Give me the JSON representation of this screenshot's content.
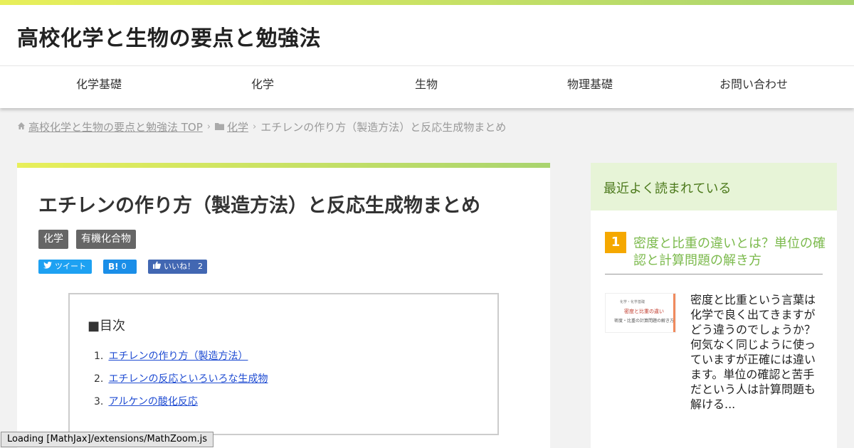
{
  "site": {
    "title": "高校化学と生物の要点と勉強法"
  },
  "nav": [
    {
      "label": "化学基礎"
    },
    {
      "label": "化学"
    },
    {
      "label": "生物"
    },
    {
      "label": "物理基礎"
    },
    {
      "label": "お問い合わせ"
    }
  ],
  "breadcrumb": {
    "home": "高校化学と生物の要点と勉強法 TOP",
    "category": "化学",
    "current": "エチレンの作り方（製造方法）と反応生成物まとめ"
  },
  "article": {
    "title": "エチレンの作り方（製造方法）と反応生成物まとめ",
    "tags": [
      "化学",
      "有機化合物"
    ],
    "share": {
      "tweet": "ツイート",
      "hatena_icon": "B!",
      "hatena_count": "0",
      "like": "いいね！",
      "like_count": "2"
    },
    "toc": {
      "title": "■目次",
      "items": [
        {
          "num": "1.",
          "label": "エチレンの作り方（製造方法）"
        },
        {
          "num": "2.",
          "label": "エチレンの反応といろいろな生成物"
        },
        {
          "num": "3.",
          "label": "アルケンの酸化反応"
        }
      ]
    }
  },
  "sidebar": {
    "heading": "最近よく読まれている",
    "ranking": [
      {
        "rank": "1",
        "title": "密度と比重の違いとは？単位の確認と計算問題の解き方",
        "thumb_line1": "化学・化学基礎",
        "thumb_line2": "密度と比重の違い",
        "thumb_line3": "密度・比重の計算問題の解き方",
        "excerpt": "密度と比重という言葉は化学で良く出てきますがどう違うのでしょうか？何気なく同じように使っていますが正確には違います。単位の確認と苦手だという人は計算問題も解ける..."
      }
    ]
  },
  "status": {
    "mathjax": "Loading [MathJax]/extensions/MathZoom.js"
  },
  "colors": {
    "accent_gradient_start": "#e8ef5a",
    "accent_gradient_end": "#a9d46f",
    "tag_bg": "#666666",
    "rank_badge": "#f5a800",
    "rank_title": "#7cba4d",
    "sidebar_head_bg": "#e7f4d7",
    "link": "#1e4bd2"
  },
  "icons": {
    "home": "home-icon",
    "folder": "folder-icon",
    "chevron": "chevron-right-icon",
    "twitter": "twitter-icon",
    "hatena": "hatena-icon",
    "like": "thumbs-up-icon"
  }
}
